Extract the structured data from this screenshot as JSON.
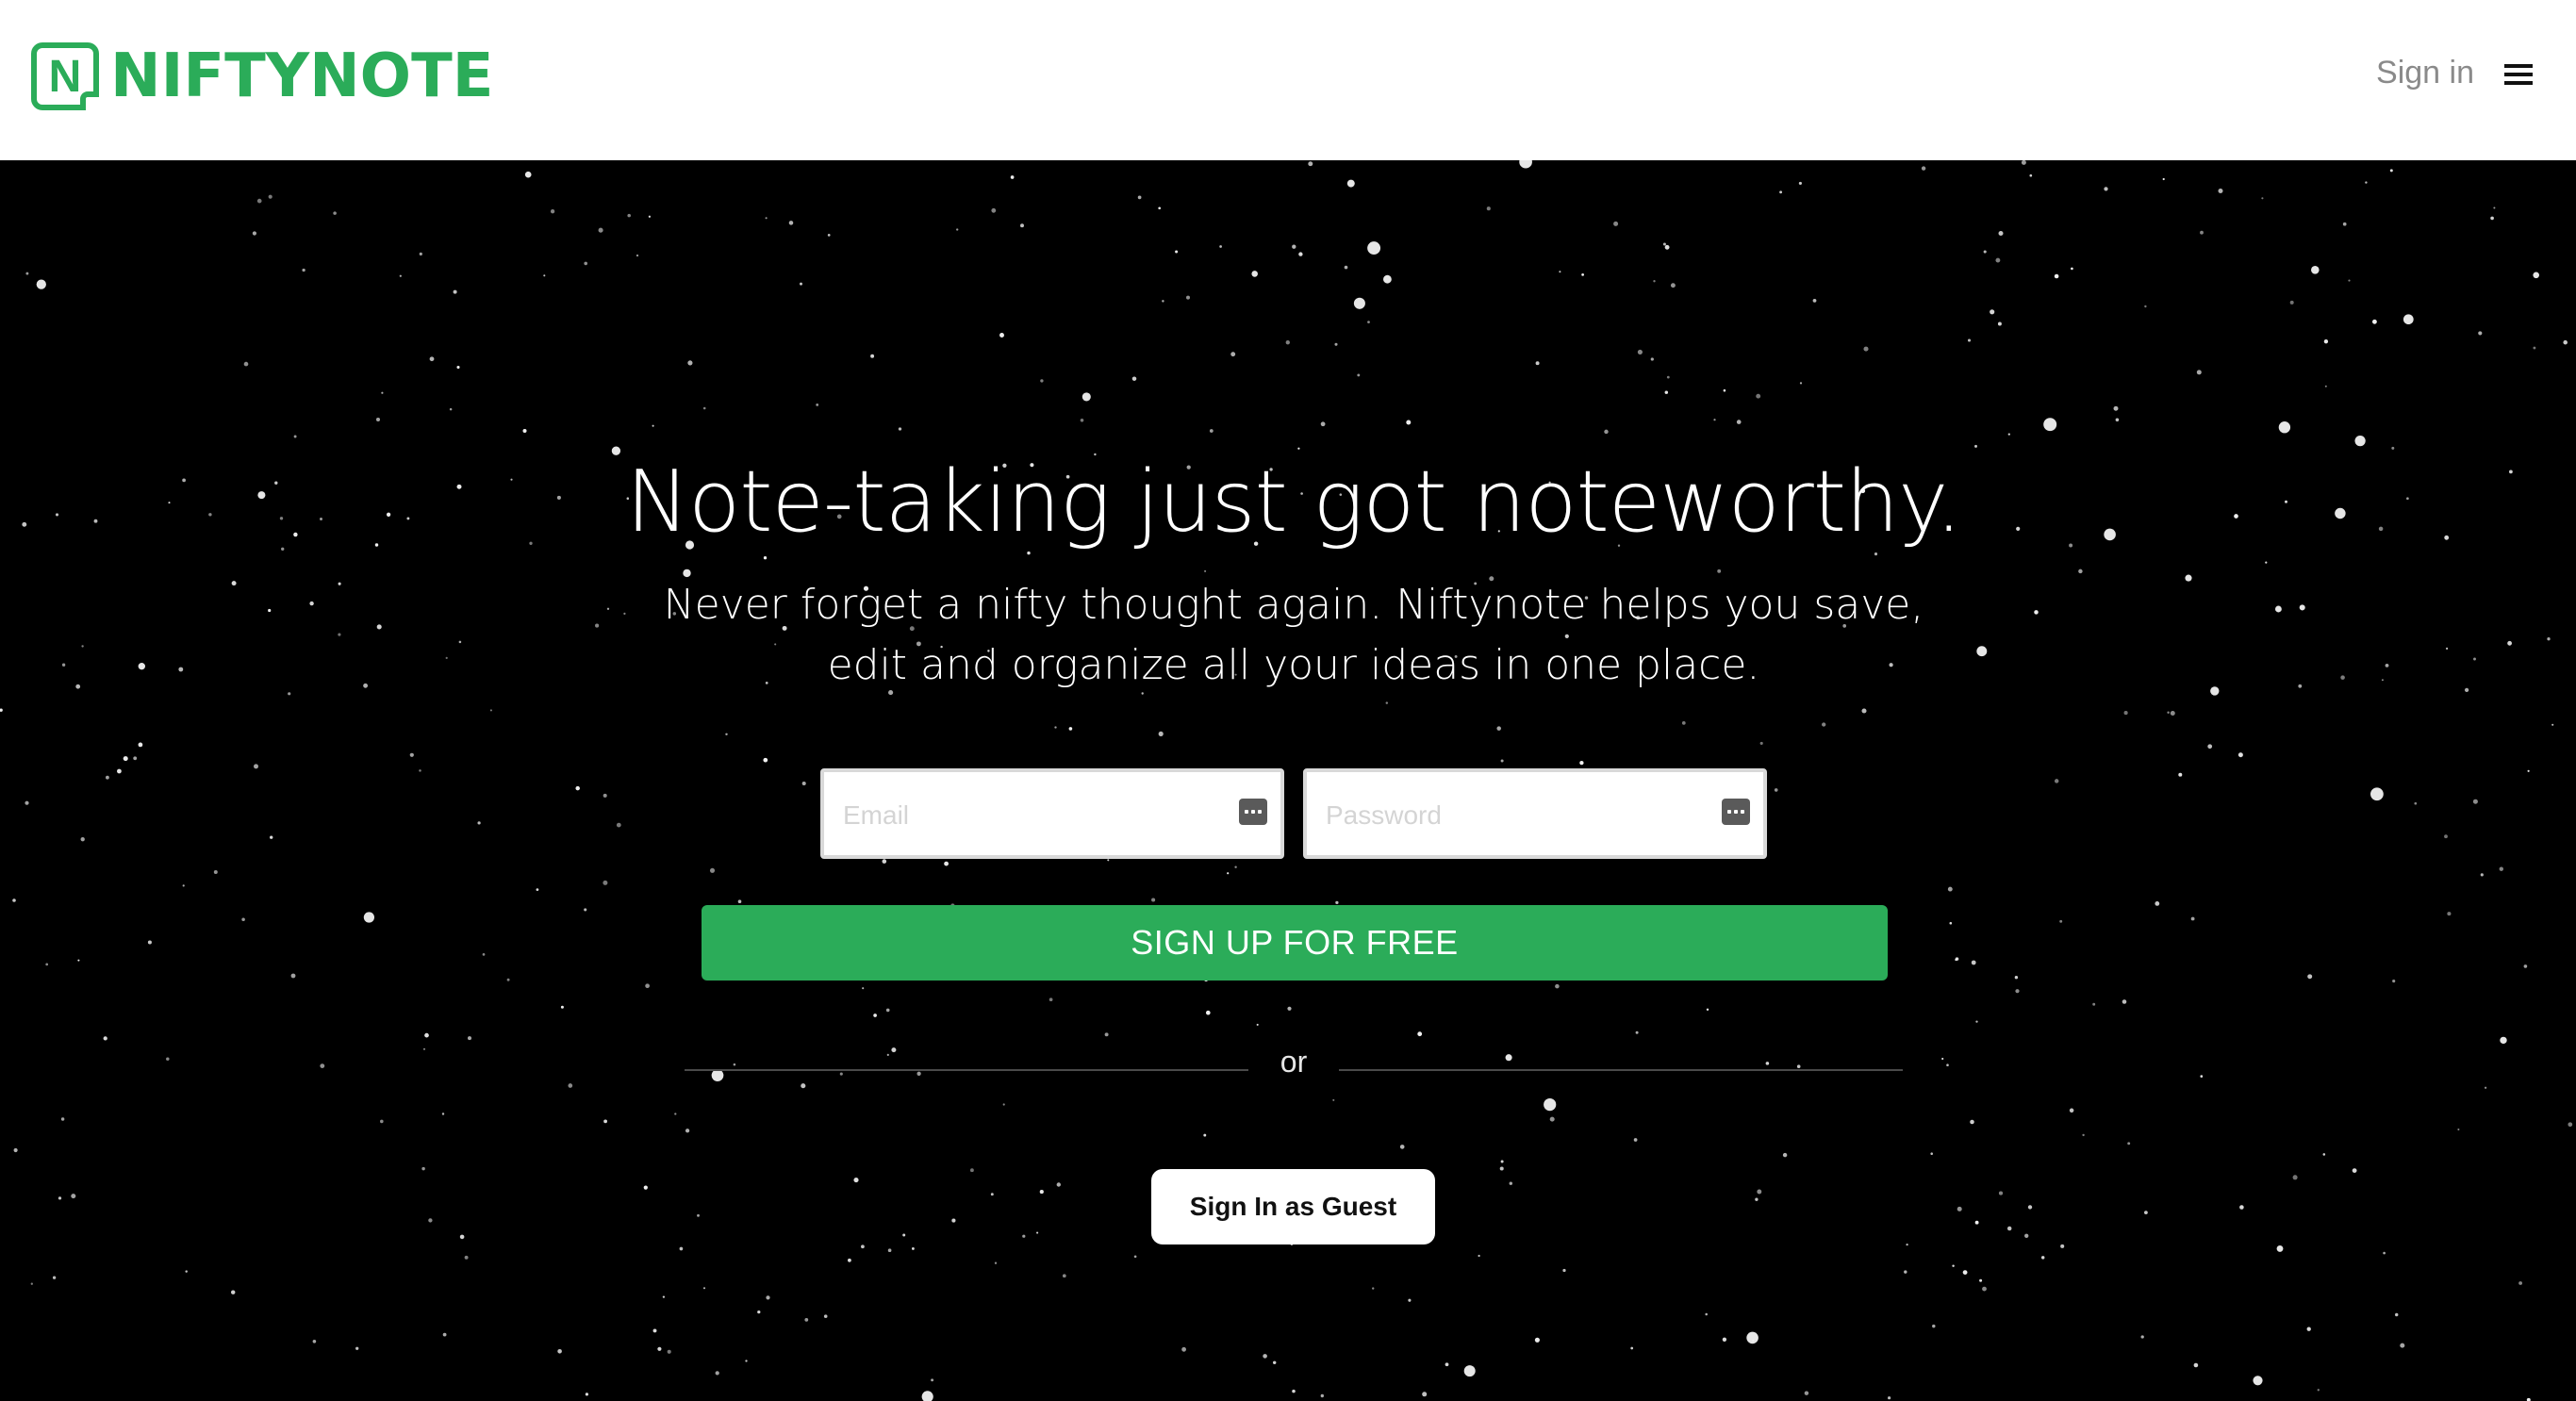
{
  "header": {
    "logo_letter": "N",
    "logo_text": "NIFTYNOTE",
    "signin_label": "Sign in",
    "menu_icon": "hamburger-menu-icon"
  },
  "hero": {
    "headline": "Note-taking just got noteworthy.",
    "subhead_line1": "Never forget a nifty thought again. Niftynote helps you save,",
    "subhead_line2": "edit and organize all your ideas in one place.",
    "email_placeholder": "Email",
    "password_placeholder": "Password",
    "field_icon": "autofill-keyboard-icon",
    "signup_label": "SIGN UP FOR FREE",
    "or_label": "or",
    "guest_label": "Sign In as Guest"
  },
  "colors": {
    "brand_green": "#2bac59",
    "background": "#000000",
    "header_bg": "#ffffff"
  }
}
